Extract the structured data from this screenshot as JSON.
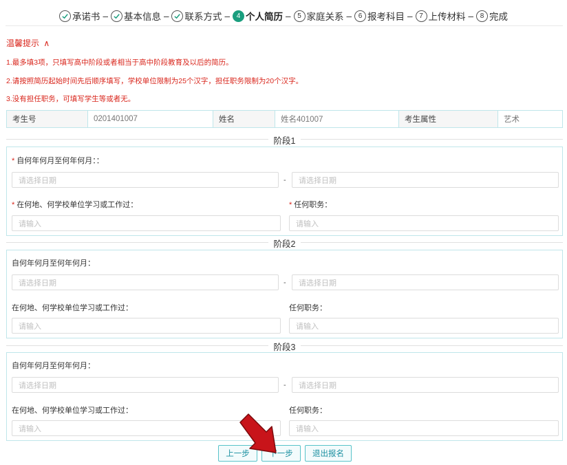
{
  "stepper": {
    "steps": [
      {
        "label": "承诺书",
        "state": "done",
        "mark": "✓"
      },
      {
        "label": "基本信息",
        "state": "done",
        "mark": "✓"
      },
      {
        "label": "联系方式",
        "state": "done",
        "mark": "✓"
      },
      {
        "label": "个人简历",
        "state": "active",
        "mark": "4"
      },
      {
        "label": "家庭关系",
        "state": "pending",
        "mark": "5"
      },
      {
        "label": "报考科目",
        "state": "pending",
        "mark": "6"
      },
      {
        "label": "上传材料",
        "state": "pending",
        "mark": "7"
      },
      {
        "label": "完成",
        "state": "pending",
        "mark": "8"
      }
    ],
    "separator": "–",
    "accent_color": "#1a9e7e"
  },
  "tips": {
    "title": "温馨提示",
    "toggle_icon": "chevron-up-icon",
    "toggle_glyph": "∧",
    "items": [
      "1.最多填3项，只填写高中阶段或者相当于高中阶段教育及以后的简历。",
      "2.请按照简历起始时间先后顺序填写，学校单位限制为25个汉字，担任职务限制为20个汉字。",
      "3.没有担任职务，可填写学生等或者无。"
    ],
    "color": "#d9261c"
  },
  "info": {
    "exam_no_label": "考生号",
    "exam_no_value": "0201401007",
    "name_label": "姓名",
    "name_value": "姓名401007",
    "attr_label": "考生属性",
    "attr_value": "艺术"
  },
  "stages": [
    {
      "title": "阶段1",
      "date_label": "自何年何月至何年何月：：",
      "date_required": true,
      "start_placeholder": "请选择日期",
      "end_placeholder": "请选择日期",
      "dash": "-",
      "place_label": "在何地、何学校单位学习或工作过：",
      "place_required": true,
      "place_placeholder": "请输入",
      "duty_label": "任何职务：",
      "duty_required": true,
      "duty_placeholder": "请输入"
    },
    {
      "title": "阶段2",
      "date_label": "自何年何月至何年何月：",
      "date_required": false,
      "start_placeholder": "请选择日期",
      "end_placeholder": "请选择日期",
      "dash": "-",
      "place_label": "在何地、何学校单位学习或工作过：",
      "place_required": false,
      "place_placeholder": "请输入",
      "duty_label": "任何职务：",
      "duty_required": false,
      "duty_placeholder": "请输入"
    },
    {
      "title": "阶段3",
      "date_label": "自何年何月至何年何月：",
      "date_required": false,
      "start_placeholder": "请选择日期",
      "end_placeholder": "请选择日期",
      "dash": "-",
      "place_label": "在何地、何学校单位学习或工作过：",
      "place_required": false,
      "place_placeholder": "请输入",
      "duty_label": "任何职务：",
      "duty_required": false,
      "duty_placeholder": "请输入"
    }
  ],
  "required_mark": "*",
  "buttons": {
    "prev": "上一步",
    "next": "下一步",
    "exit": "退出报名"
  },
  "arrow": {
    "icon": "arrow-down-right-icon",
    "color": "#c8141a"
  }
}
